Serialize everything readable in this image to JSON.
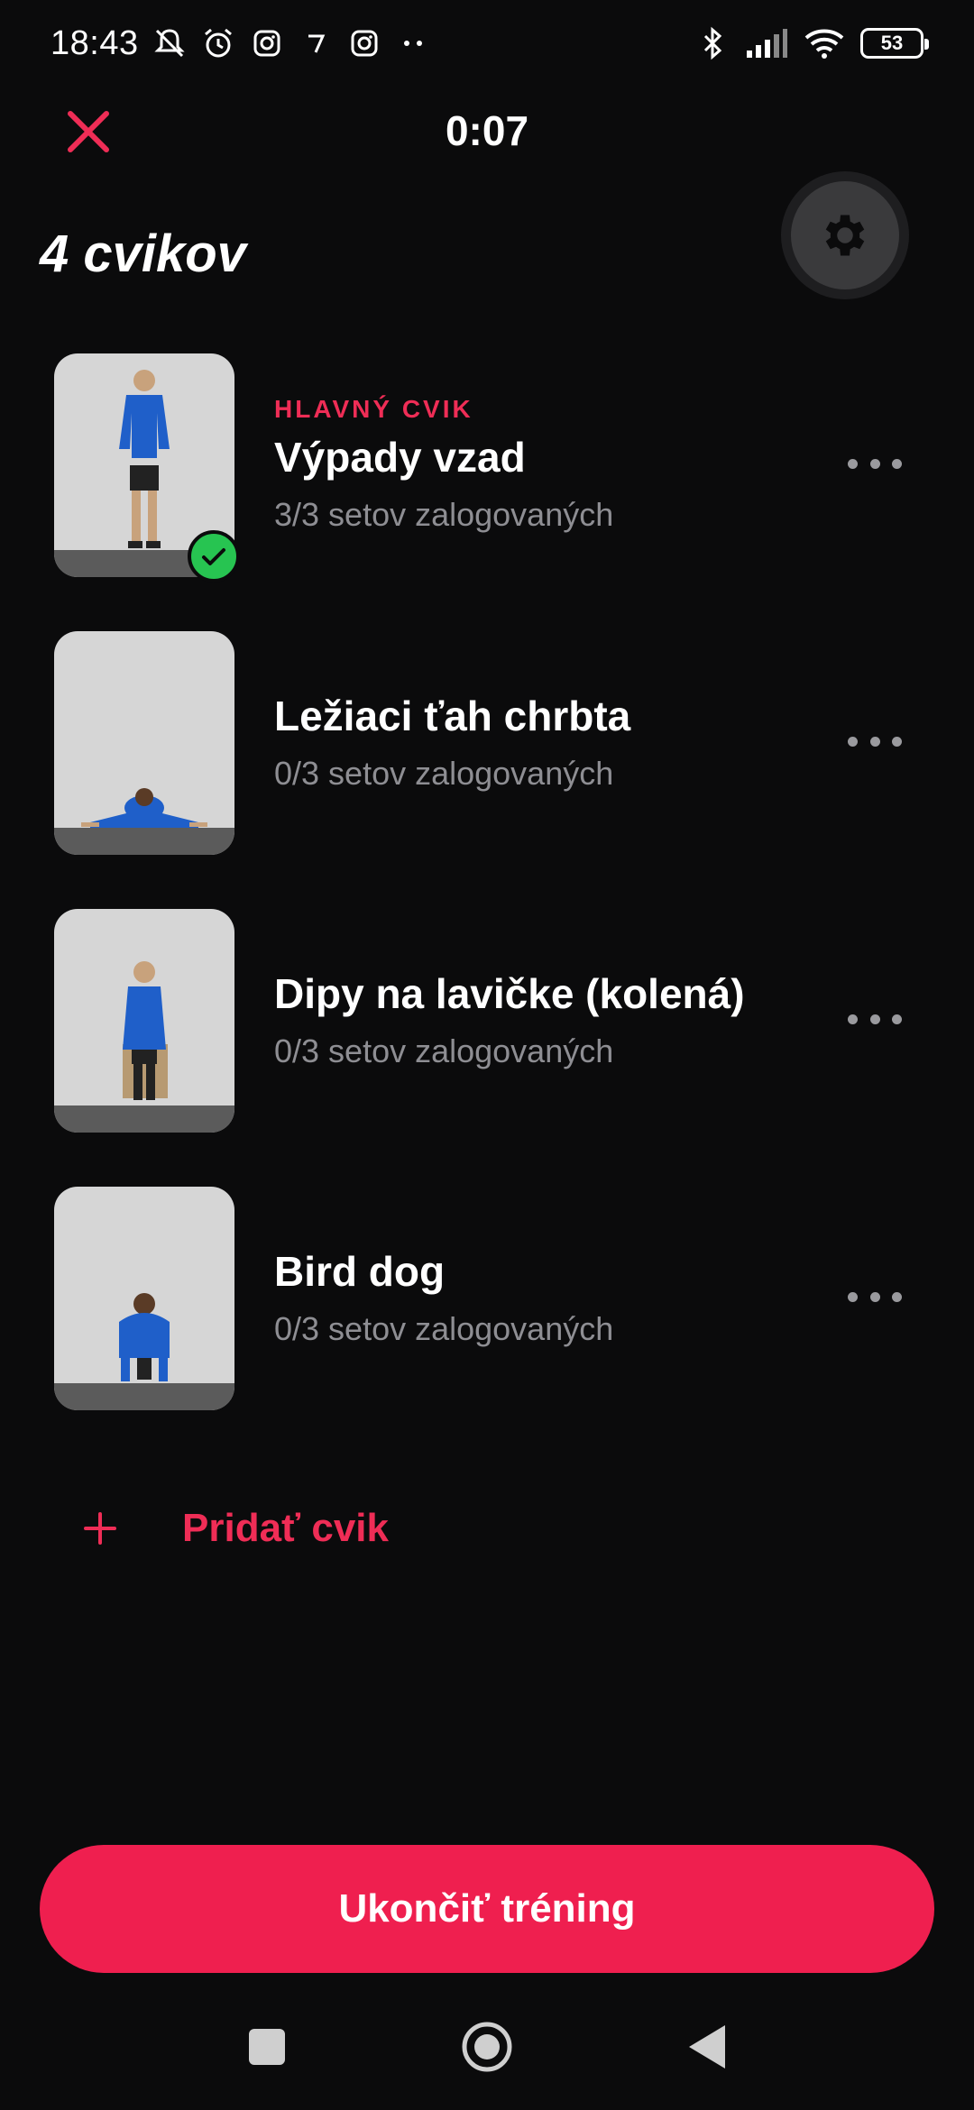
{
  "status_bar": {
    "time": "18:43",
    "battery": "53",
    "left_icons": [
      "bell-off-icon",
      "alarm-icon",
      "instagram-icon",
      "tiktok-like-icon",
      "instagram-icon",
      "more-dots-icon"
    ],
    "right_icons": [
      "bluetooth-icon",
      "signal-icon",
      "wifi-icon",
      "battery-icon"
    ]
  },
  "header": {
    "timer": "0:07"
  },
  "page": {
    "title": "4 cvikov"
  },
  "exercises": [
    {
      "tag": "HLAVNÝ CVIK",
      "name": "Výpady vzad",
      "sets": "3/3 setov zalogovaných",
      "completed": true
    },
    {
      "tag": "",
      "name": "Ležiaci ťah chrbta",
      "sets": "0/3 setov zalogovaných",
      "completed": false
    },
    {
      "tag": "",
      "name": "Dipy na lavičke (kolená)",
      "sets": "0/3 setov zalogovaných",
      "completed": false
    },
    {
      "tag": "",
      "name": "Bird dog",
      "sets": "0/3 setov zalogovaných",
      "completed": false
    }
  ],
  "add_exercise": {
    "label": "Pridať cvik"
  },
  "finish_button": {
    "label": "Ukončiť tréning"
  },
  "colors": {
    "accent": "#ef2d56",
    "background": "#0b0b0c",
    "success": "#27c451",
    "muted_text": "#8e8e93"
  }
}
